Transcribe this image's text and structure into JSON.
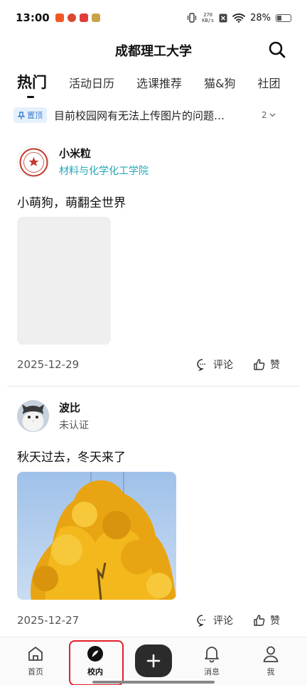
{
  "status_bar": {
    "time": "13:00",
    "net_speed_value": "270",
    "net_speed_unit": "KB/s",
    "battery_percent": "28%",
    "battery_level": 0.28
  },
  "header": {
    "title": "成都理工大学",
    "search_icon": "search-icon"
  },
  "tabs": [
    {
      "label": "热门",
      "active": true
    },
    {
      "label": "活动日历",
      "active": false
    },
    {
      "label": "选课推荐",
      "active": false
    },
    {
      "label": "猫&狗",
      "active": false
    },
    {
      "label": "社团",
      "active": false
    }
  ],
  "pinned": {
    "badge_label": "置顶",
    "text": "目前校园网有无法上传图片的问题…",
    "count": "2"
  },
  "posts": [
    {
      "author": "小米粒",
      "department": "材料与化学化工学院",
      "text": "小萌狗，萌翻全世界",
      "date": "2025-12-29",
      "comment_label": "评论",
      "like_label": "赞"
    },
    {
      "author": "波比",
      "department": "未认证",
      "text": "秋天过去，冬天来了",
      "date": "2025-12-27",
      "comment_label": "评论",
      "like_label": "赞"
    }
  ],
  "bottom_nav": {
    "items": [
      {
        "label": "首页",
        "icon": "home-icon"
      },
      {
        "label": "校内",
        "icon": "compass-icon",
        "active": true
      },
      {
        "label": "",
        "icon": "plus-icon"
      },
      {
        "label": "消息",
        "icon": "bell-icon"
      },
      {
        "label": "我",
        "icon": "user-icon"
      }
    ]
  },
  "colors": {
    "accent_teal": "#21a7b8",
    "pin_blue": "#3d7fd6",
    "highlight_red": "#e0202a"
  }
}
